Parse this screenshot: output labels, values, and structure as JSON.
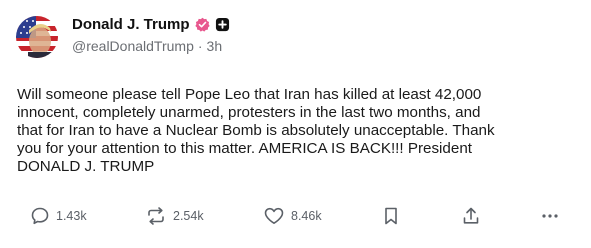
{
  "author": {
    "display_name": "Donald J. Trump",
    "handle": "@realDonaldTrump",
    "separator": "·",
    "time_ago": "3h",
    "verified_color": "#e8588e"
  },
  "post": {
    "text": "Will someone please tell Pope Leo that Iran has killed at least 42,000\ninnocent, completely unarmed, protesters in the last two months, and\nthat for Iran to have a Nuclear Bomb is absolutely unacceptable. Thank\nyou for your attention to this matter. AMERICA IS BACK!!! President\nDONALD J. TRUMP"
  },
  "actions": {
    "replies": "1.43k",
    "retruths": "2.54k",
    "likes": "8.46k"
  },
  "icons": {
    "reply": "comment-bubble-icon",
    "retruth": "repost-arrows-icon",
    "like": "heart-icon",
    "bookmark": "bookmark-icon",
    "share": "share-upload-icon",
    "more": "more-dots-icon"
  }
}
